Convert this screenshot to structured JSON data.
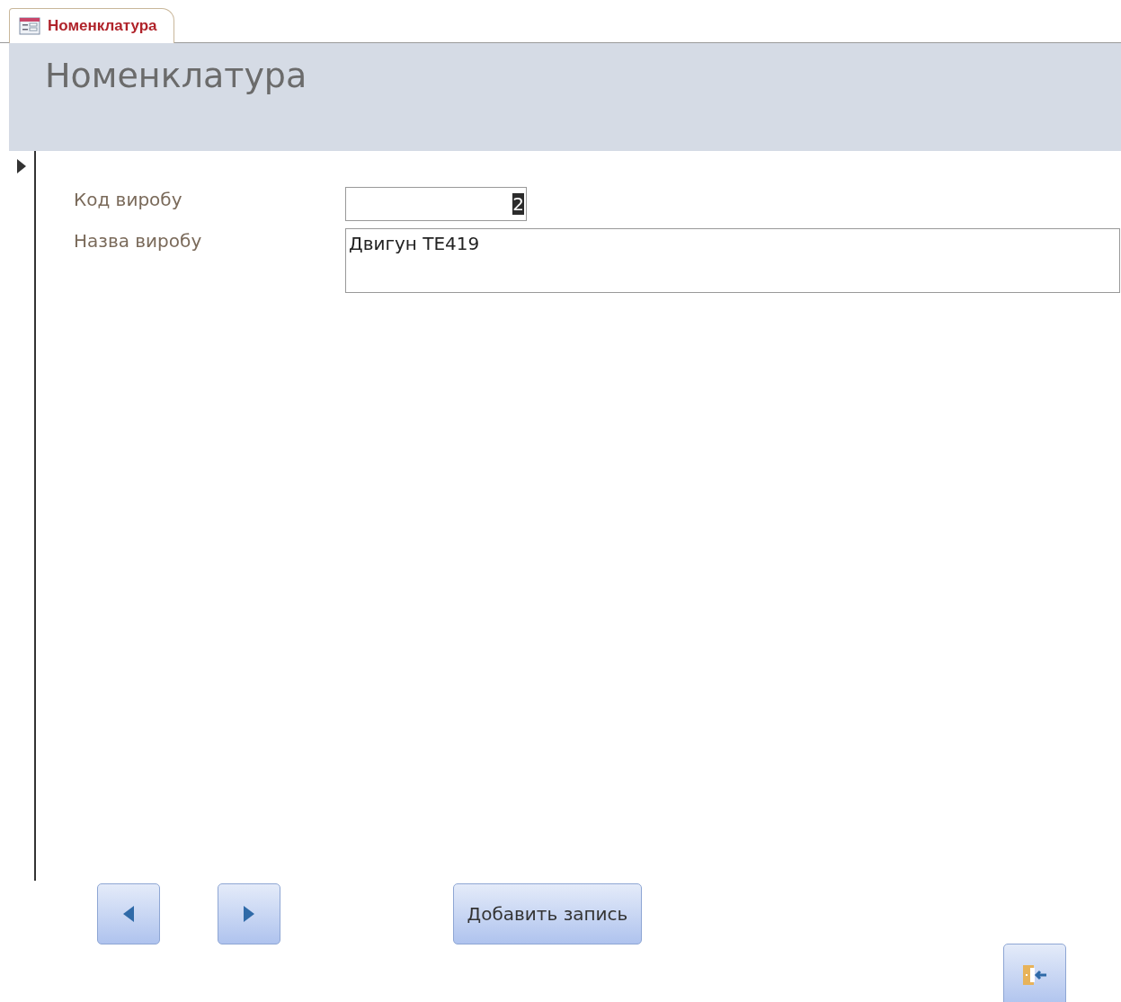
{
  "tab": {
    "label": "Номенклатура",
    "selected": true
  },
  "header": {
    "title": "Номенклатура"
  },
  "record_selector": {
    "current": true
  },
  "fields": [
    {
      "kind": "single",
      "label": "Код виробу",
      "value": "2",
      "highlighted": true
    },
    {
      "kind": "multi",
      "label": "Назва виробу",
      "value": "Двигун ТЕ419",
      "highlighted": false
    }
  ],
  "buttons": [
    {
      "kind": "previous"
    },
    {
      "kind": "next"
    },
    {
      "kind": "text",
      "label": "Добавить запись"
    },
    {
      "kind": "exit"
    }
  ]
}
